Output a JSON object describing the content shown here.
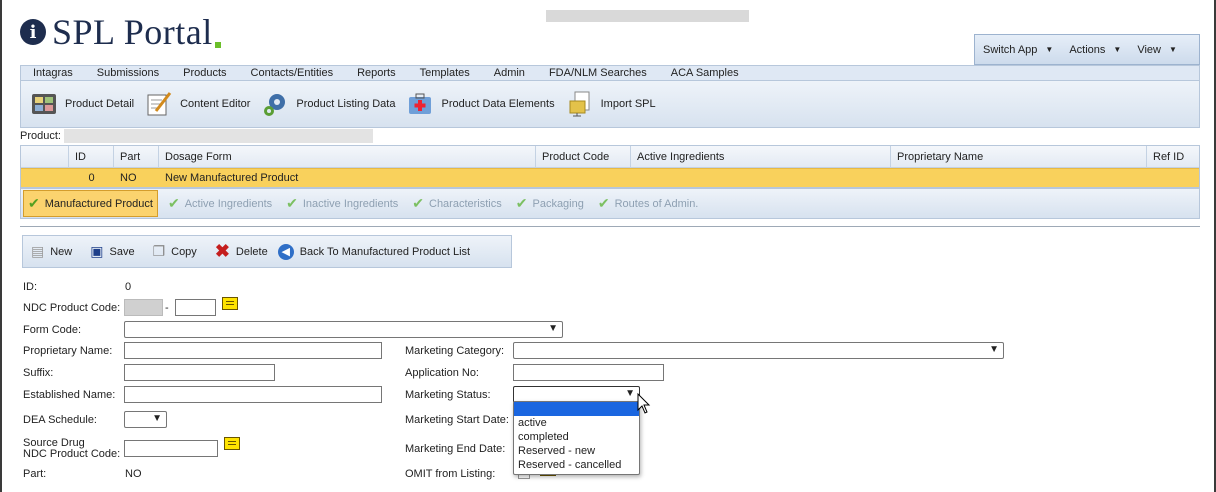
{
  "brand": {
    "name": "SPL Portal",
    "badge": "i"
  },
  "appbar": {
    "items": [
      "Switch App",
      "Actions",
      "View"
    ]
  },
  "menu": [
    "Intagras",
    "Submissions",
    "Products",
    "Contacts/Entities",
    "Reports",
    "Templates",
    "Admin",
    "FDA/NLM Searches",
    "ACA Samples"
  ],
  "toolbar": [
    "Product Detail",
    "Content Editor",
    "Product Listing Data",
    "Product Data Elements",
    "Import SPL"
  ],
  "product_label": "Product:",
  "grid": {
    "columns": [
      "ID",
      "Part",
      "Dosage Form",
      "Product Code",
      "Active Ingredients",
      "Proprietary Name",
      "Ref ID"
    ],
    "row": {
      "id": "0",
      "part": "NO",
      "dosage_form": "New Manufactured Product",
      "product_code": "",
      "active_ingredients": "",
      "proprietary_name": "",
      "ref_id": ""
    }
  },
  "subtabs": [
    "Manufactured Product",
    "Active Ingredients",
    "Inactive Ingredients",
    "Characteristics",
    "Packaging",
    "Routes of Admin."
  ],
  "actions": [
    "New",
    "Save",
    "Copy",
    "Delete",
    "Back To Manufactured Product List"
  ],
  "form": {
    "id_label": "ID:",
    "id_value": "0",
    "ndc_label": "NDC Product Code:",
    "ndc_sep": "-",
    "form_code_label": "Form Code:",
    "proprietary_name_label": "Proprietary Name:",
    "suffix_label": "Suffix:",
    "established_name_label": "Established Name:",
    "dea_label": "DEA Schedule:",
    "source_drug_label_1": "Source Drug",
    "source_drug_label_2": "NDC Product Code:",
    "part_label": "Part:",
    "part_value": "NO",
    "marketing_category_label": "Marketing Category:",
    "application_no_label": "Application No:",
    "marketing_status_label": "Marketing Status:",
    "marketing_start_label": "Marketing Start Date:",
    "marketing_end_label": "Marketing End Date:",
    "omit_label": "OMIT from Listing:"
  },
  "marketing_status_options": [
    "",
    "active",
    "completed",
    "Reserved - new",
    "Reserved - cancelled"
  ]
}
